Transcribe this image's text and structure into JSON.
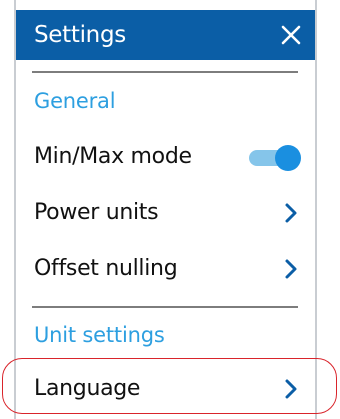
{
  "header": {
    "title": "Settings",
    "close_icon": "close-icon"
  },
  "sections": {
    "general": "General",
    "unit_settings": "Unit settings"
  },
  "items": {
    "min_max_mode": {
      "label": "Min/Max mode",
      "toggle_on": true
    },
    "power_units": {
      "label": "Power units",
      "icon": "chevron-right-icon"
    },
    "offset_nulling": {
      "label": "Offset nulling",
      "icon": "chevron-right-icon"
    },
    "language": {
      "label": "Language",
      "icon": "chevron-right-icon"
    }
  },
  "colors": {
    "header_bg": "#0b5ea6",
    "section_text": "#2d9fe0",
    "toggle_knob": "#1a8fe0",
    "toggle_track": "#85c5ea",
    "highlight": "#d9242b"
  }
}
